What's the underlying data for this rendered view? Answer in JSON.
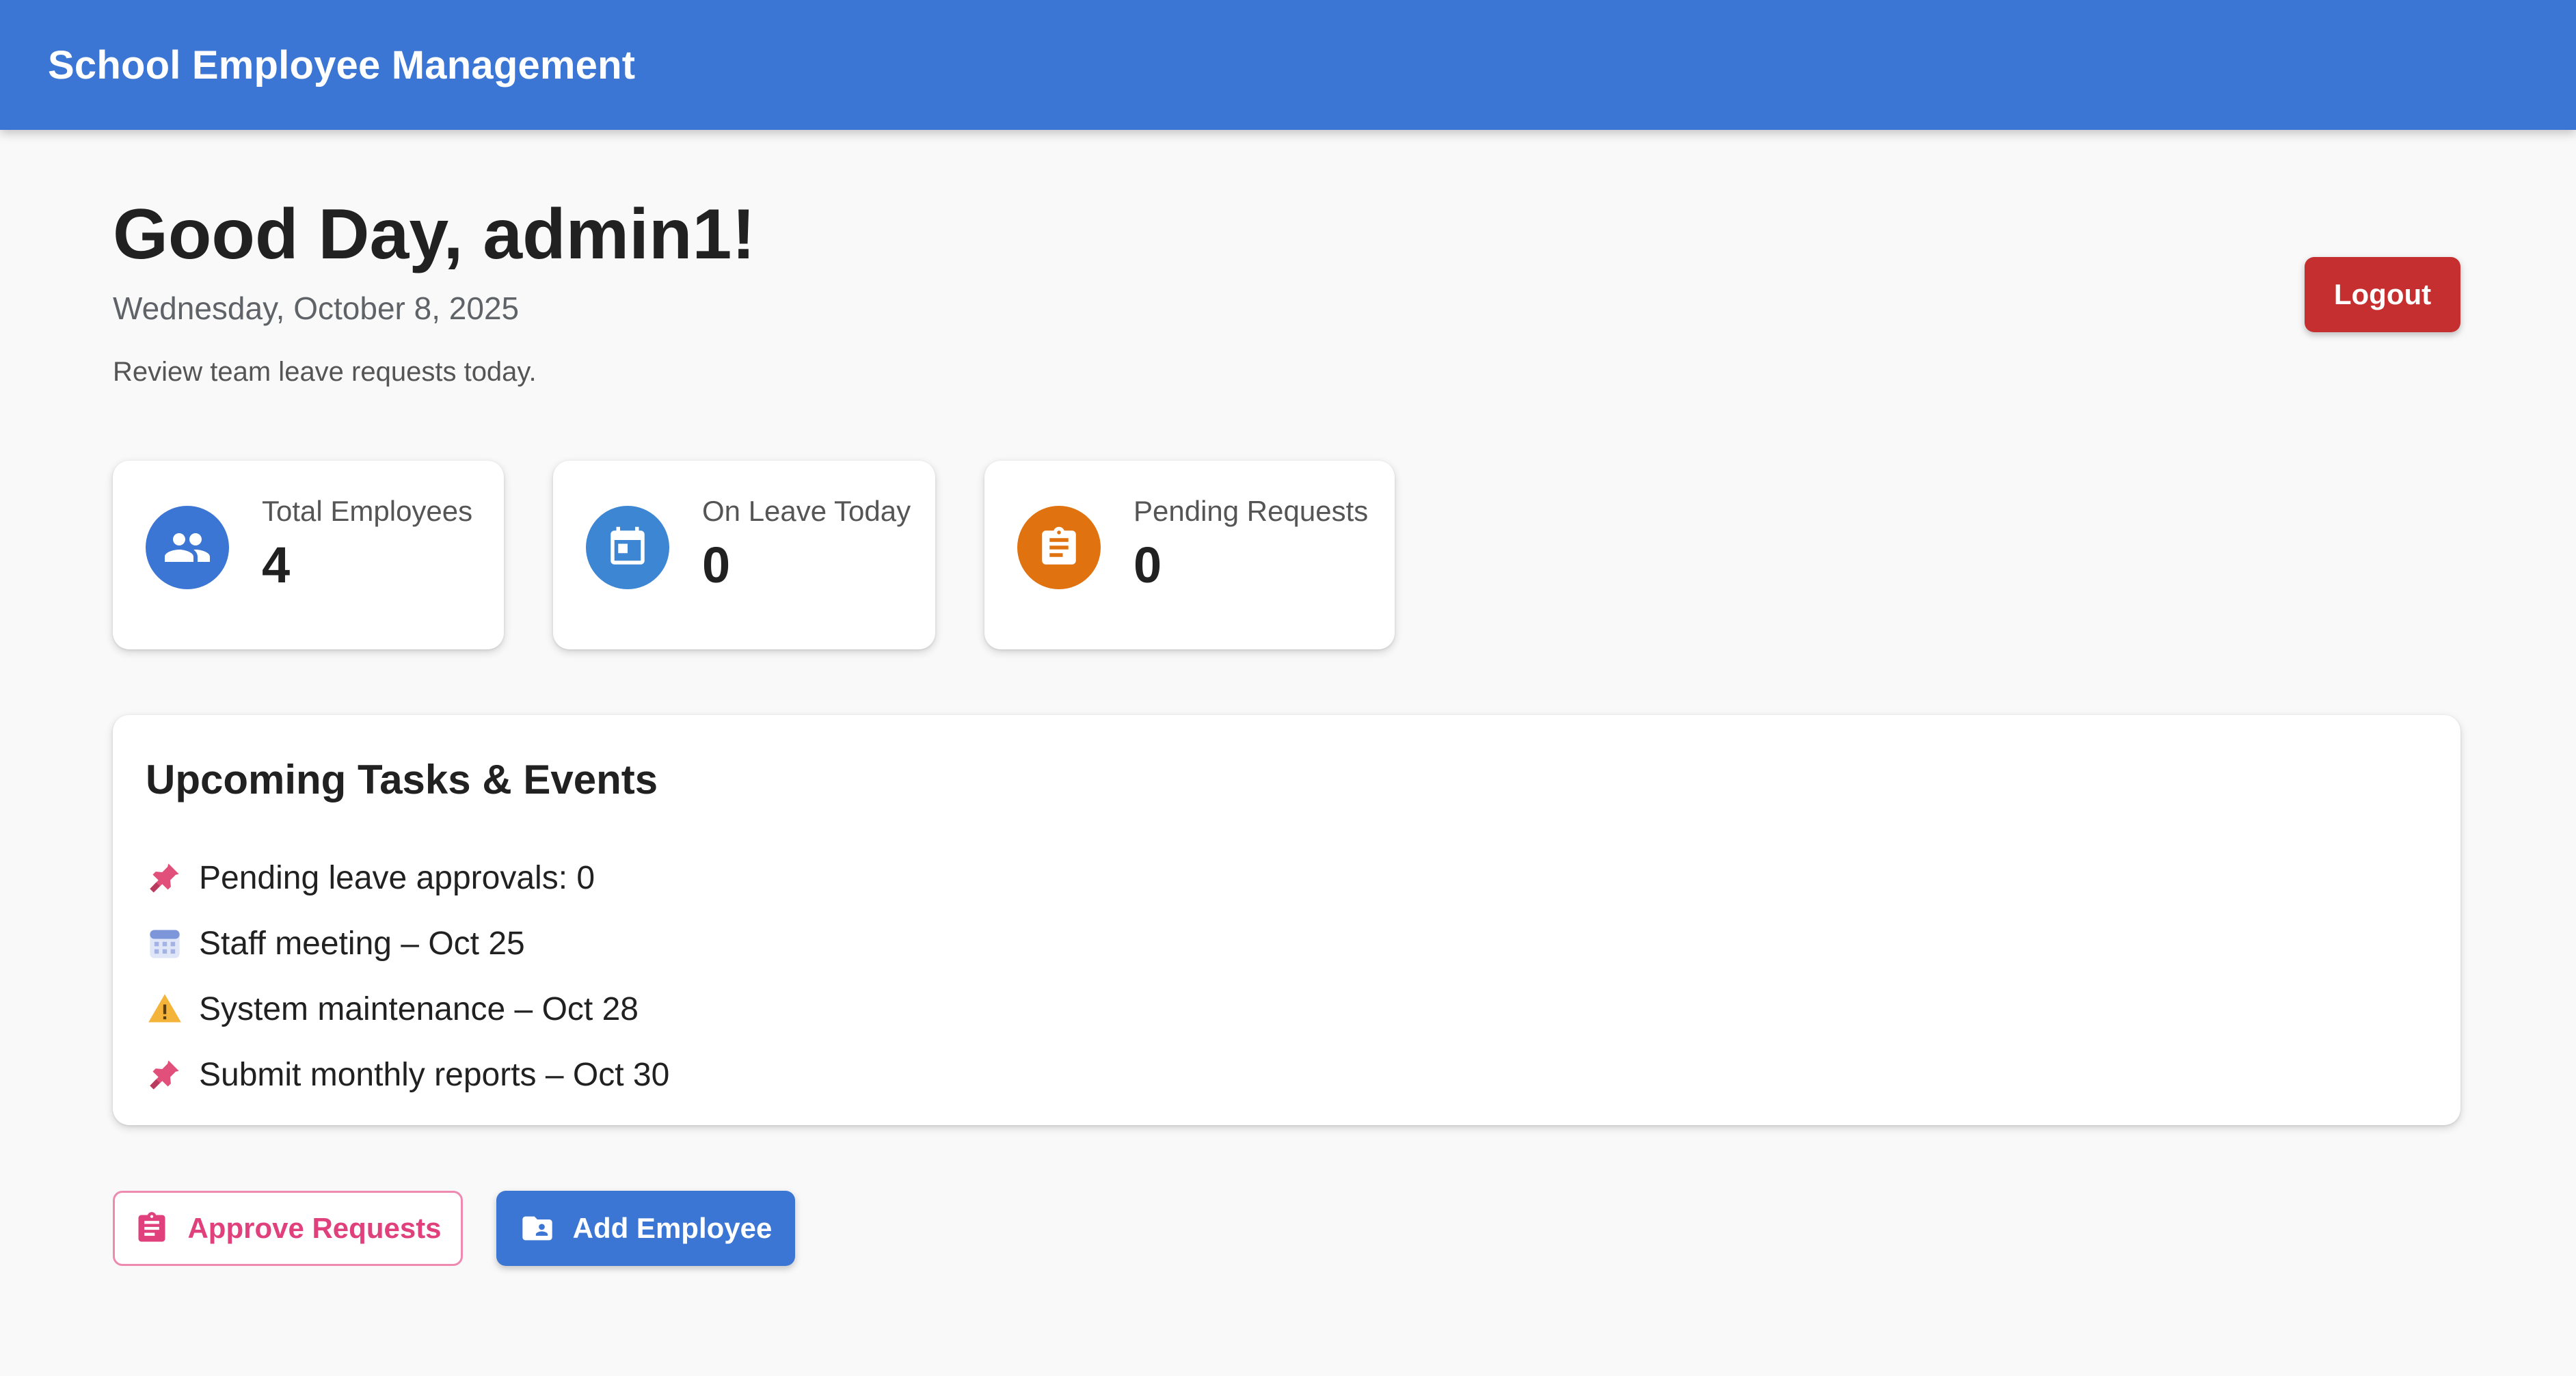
{
  "app": {
    "title": "School Employee Management"
  },
  "header": {
    "greeting": "Good Day, admin1!",
    "date": "Wednesday, October 8, 2025",
    "subtitle": "Review team leave requests today.",
    "logout_label": "Logout"
  },
  "stats": [
    {
      "label": "Total Employees",
      "value": "4",
      "icon": "group-icon",
      "color": "#3c76d4"
    },
    {
      "label": "On Leave Today",
      "value": "0",
      "icon": "calendar-icon",
      "color": "#3c86d4"
    },
    {
      "label": "Pending Requests",
      "value": "0",
      "icon": "clipboard-icon",
      "color": "#e0720f"
    }
  ],
  "tasks": {
    "title": "Upcoming Tasks & Events",
    "items": [
      {
        "icon": "pushpin-icon",
        "text": "Pending leave approvals: 0"
      },
      {
        "icon": "calendar-emoji-icon",
        "text": "Staff meeting – Oct 25"
      },
      {
        "icon": "warning-icon",
        "text": "System maintenance – Oct 28"
      },
      {
        "icon": "pushpin-icon",
        "text": "Submit monthly reports – Oct 30"
      }
    ]
  },
  "actions": {
    "approve_label": "Approve Requests",
    "add_label": "Add Employee"
  },
  "colors": {
    "primary": "#3c76d4",
    "danger": "#c62f2f",
    "accent_pink": "#e0407c",
    "orange": "#e0720f"
  }
}
